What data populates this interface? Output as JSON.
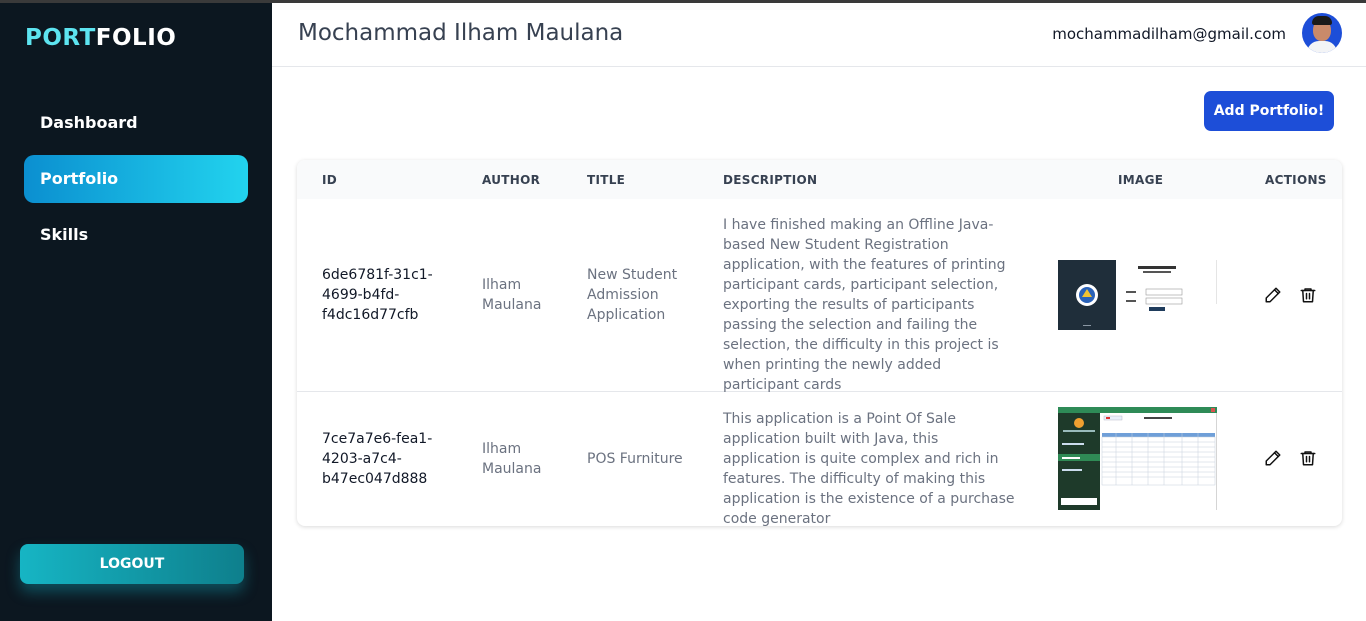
{
  "sidebar": {
    "brand_part1": "PORT",
    "brand_part2": "FOLIO",
    "items": [
      {
        "label": "Dashboard",
        "active": false
      },
      {
        "label": "Portfolio",
        "active": true
      },
      {
        "label": "Skills",
        "active": false
      }
    ],
    "logout_label": "LOGOUT"
  },
  "header": {
    "title": "Mochammad Ilham Maulana",
    "email": "mochammadilham@gmail.com"
  },
  "main": {
    "add_button": "Add Portfolio!",
    "table": {
      "columns": [
        "ID",
        "AUTHOR",
        "TITLE",
        "DESCRIPTION",
        "IMAGE",
        "ACTIONS"
      ],
      "rows": [
        {
          "id": "6de6781f-31c1-4699-b4fd-f4dc16d77cfb",
          "author": "Ilham Maulana",
          "title": "New Student Admission Application",
          "description": "I have finished making an Offline Java-based New Student Registration application, with the features of printing participant cards, participant selection, exporting the results of participants passing the selection and failing the selection, the difficulty in this project is when printing the newly added participant cards"
        },
        {
          "id": "7ce7a7e6-fea1-4203-a7c4-b47ec047d888",
          "author": "Ilham Maulana",
          "title": "POS Furniture",
          "description": "This application is a Point Of Sale application built with Java, this application is quite complex and rich in features. The difficulty of making this application is the existence of a purchase code generator"
        }
      ]
    }
  },
  "colors": {
    "sidebar_bg": "#0c1720",
    "brand_accent": "#5de4f0",
    "active_gradient_start": "#0b8fd0",
    "active_gradient_end": "#22d3ee",
    "primary_button": "#1d4ed8"
  },
  "icons": [
    "pencil-icon",
    "trash-icon"
  ]
}
